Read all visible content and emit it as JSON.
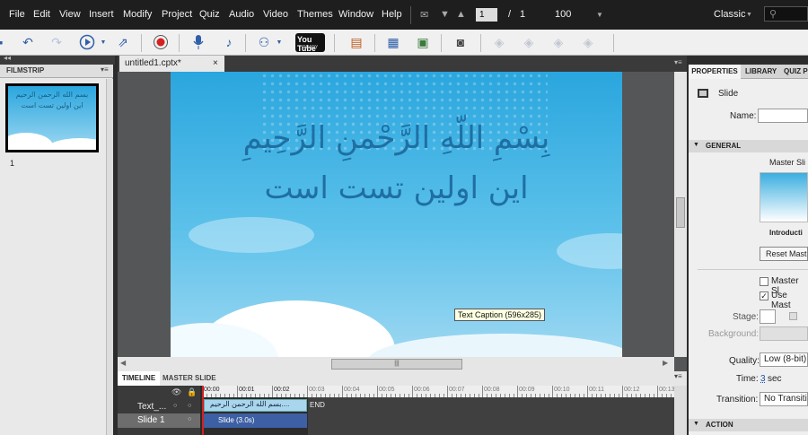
{
  "menu": {
    "items": [
      "File",
      "Edit",
      "View",
      "Insert",
      "Modify",
      "Project",
      "Quiz",
      "Audio",
      "Video",
      "Themes",
      "Window",
      "Help"
    ],
    "page_current": "1",
    "page_sep": "/",
    "page_total": "1",
    "zoom": "100",
    "workspace": "Classic"
  },
  "toolbar": {
    "youtube_label": "You Tube",
    "youtube_sub": "READY"
  },
  "filmstrip": {
    "title": "FILMSTRIP",
    "thumb_line1": "بسم الله الرحمن الرحيم",
    "thumb_line2": "اين اولين تست است",
    "slide_number": "1"
  },
  "document": {
    "tab_title": "untitled1.cptx*",
    "close": "×"
  },
  "slide": {
    "caption_line1": "بِسْمِ اللّهِ الرَّحْمنِ الرَّحِيمِ",
    "caption_line2": "اين اولين تست است",
    "tooltip": "Text Caption (596x285)"
  },
  "timeline": {
    "tabs": [
      "TIMELINE",
      "MASTER SLIDE"
    ],
    "rows": [
      {
        "name": "Text_..."
      },
      {
        "name": "Slide 1"
      }
    ],
    "ticks": [
      "00:00",
      "00:01",
      "00:02",
      "00:03",
      "00:04",
      "00:05",
      "00:06",
      "00:07",
      "00:08",
      "00:09",
      "00:10",
      "00:11",
      "00:12",
      "00:13"
    ],
    "text_bar": "بسم الله الرحمن الرحيم....",
    "slide_bar": "Slide (3.0s)",
    "end_label": "END"
  },
  "properties": {
    "tabs": [
      "PROPERTIES",
      "LIBRARY",
      "QUIZ P"
    ],
    "object_type": "Slide",
    "name_label": "Name:",
    "name_value": "",
    "general_header": "GENERAL",
    "master_slide_label": "Master Sli",
    "master_name": "Introducti",
    "reset_button": "Reset Mast",
    "master_obj_label": "Master Sl",
    "use_master_label": "Use Mast",
    "stage_label": "Stage:",
    "background_label": "Background:",
    "quality_label": "Quality:",
    "quality_value": "Low (8-bit)",
    "time_label": "Time:",
    "time_value": "3",
    "time_unit": "sec",
    "transition_label": "Transition:",
    "transition_value": "No Transiti",
    "action_header": "ACTION"
  },
  "colors": {
    "accent": "#2aa6de",
    "playhead": "#d32020",
    "timeline_bar": "#a9d6ee",
    "slide_bar": "#3d5fa3"
  }
}
